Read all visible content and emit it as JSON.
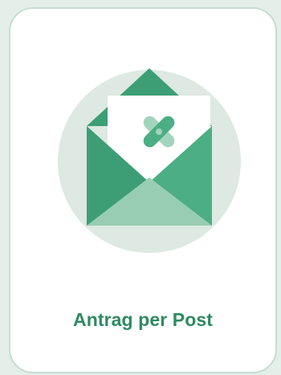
{
  "card": {
    "label": "Antrag per Post",
    "illustration_icon": "open-envelope-with-letter-icon",
    "badge_icon": "cross-badge-icon"
  },
  "colors": {
    "page_background": "#e4efe9",
    "card_background": "#ffffff",
    "card_border": "#c6ddd2",
    "accent_text": "#2e8a62",
    "envelope_dark": "#3d9e75",
    "envelope_medium": "#4cae84",
    "envelope_light": "#98cdb4",
    "circle_background": "#dde9e2"
  }
}
